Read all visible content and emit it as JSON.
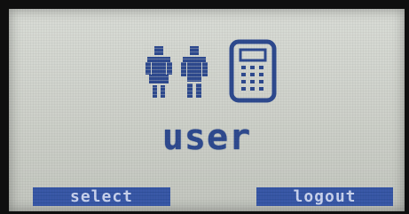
{
  "screen": {
    "label": "user"
  },
  "icons": {
    "users": "two-people-icon",
    "keypad": "keypad-terminal-icon"
  },
  "softkeys": {
    "left_label": "select",
    "right_label": "logout"
  },
  "colors": {
    "lcd_background": "#cfd2cb",
    "pixel_ink": "#2e4a8f",
    "softkey_background": "#3a59a8",
    "softkey_text": "#c9d3ee"
  }
}
